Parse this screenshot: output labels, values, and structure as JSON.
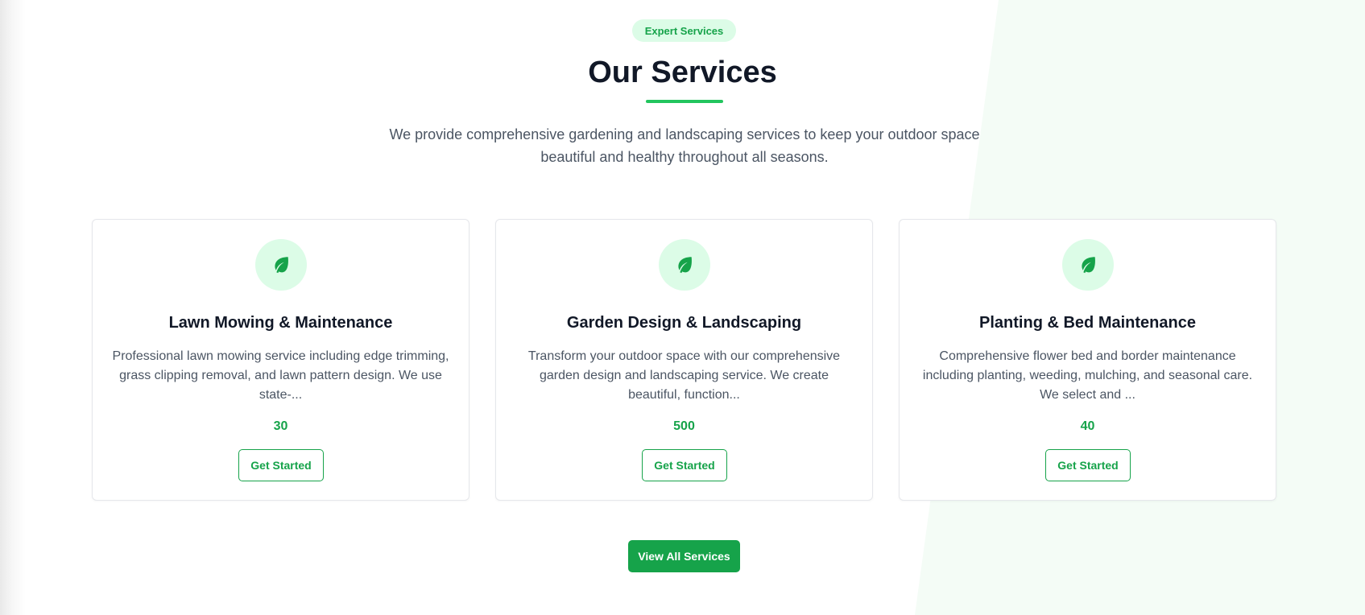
{
  "header": {
    "badge": "Expert Services",
    "title": "Our Services",
    "subtitle": "We provide comprehensive gardening and landscaping services to keep your outdoor space beautiful and healthy throughout all seasons."
  },
  "services": [
    {
      "icon": "leaf-icon",
      "title": "Lawn Mowing & Maintenance",
      "description": "Professional lawn mowing service including edge trimming, grass clipping removal, and lawn pattern design. We use state-...",
      "price": "30",
      "button_label": "Get Started"
    },
    {
      "icon": "leaf-icon",
      "title": "Garden Design & Landscaping",
      "description": "Transform your outdoor space with our comprehensive garden design and landscaping service. We create beautiful, function...",
      "price": "500",
      "button_label": "Get Started"
    },
    {
      "icon": "leaf-icon",
      "title": "Planting & Bed Maintenance",
      "description": "Comprehensive flower bed and border maintenance including planting, weeding, mulching, and seasonal care. We select and ...",
      "price": "40",
      "button_label": "Get Started"
    }
  ],
  "view_all_label": "View All Services",
  "colors": {
    "accent": "#16a34a",
    "accent_light": "#dcfce7",
    "underline": "#22c55e",
    "heading": "#111827",
    "body_text": "#4b5563"
  }
}
